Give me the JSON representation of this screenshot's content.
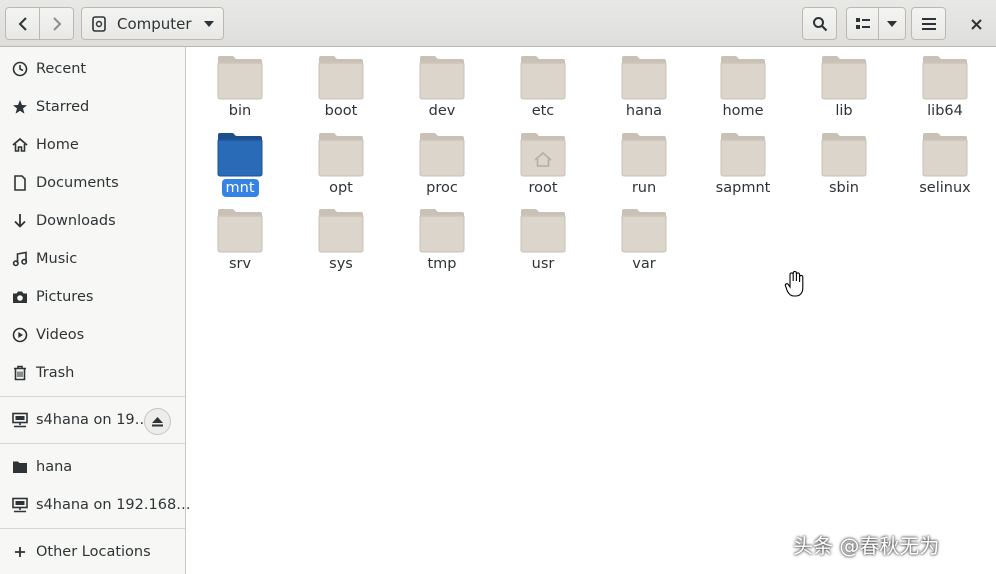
{
  "header": {
    "location_label": "Computer"
  },
  "sidebar": {
    "items": [
      {
        "label": "Recent",
        "icon": "clock-icon"
      },
      {
        "label": "Starred",
        "icon": "star-icon"
      },
      {
        "label": "Home",
        "icon": "home-icon"
      },
      {
        "label": "Documents",
        "icon": "document-icon"
      },
      {
        "label": "Downloads",
        "icon": "download-icon"
      },
      {
        "label": "Music",
        "icon": "music-icon"
      },
      {
        "label": "Pictures",
        "icon": "camera-icon"
      },
      {
        "label": "Videos",
        "icon": "video-icon"
      },
      {
        "label": "Trash",
        "icon": "trash-icon"
      }
    ],
    "network_mount": {
      "label": "s4hana on 19…",
      "icon": "network-drive-icon"
    },
    "bookmarks": [
      {
        "label": "hana",
        "icon": "folder-icon"
      },
      {
        "label": "s4hana on 192.168…",
        "icon": "network-drive-icon"
      }
    ],
    "other_locations": {
      "label": "Other Locations",
      "icon": "plus-icon"
    }
  },
  "files": [
    {
      "name": "bin"
    },
    {
      "name": "boot"
    },
    {
      "name": "dev"
    },
    {
      "name": "etc"
    },
    {
      "name": "hana"
    },
    {
      "name": "home"
    },
    {
      "name": "lib"
    },
    {
      "name": "lib64"
    },
    {
      "name": "mnt",
      "selected": true
    },
    {
      "name": "opt"
    },
    {
      "name": "proc"
    },
    {
      "name": "root",
      "icon": "home-folder"
    },
    {
      "name": "run"
    },
    {
      "name": "sapmnt"
    },
    {
      "name": "sbin"
    },
    {
      "name": "selinux"
    },
    {
      "name": "srv"
    },
    {
      "name": "sys"
    },
    {
      "name": "tmp"
    },
    {
      "name": "usr"
    },
    {
      "name": "var"
    }
  ],
  "watermark": "头条 @春秋无为",
  "colors": {
    "folder": "#dcd5cc",
    "folder_tab": "#c9c0b6",
    "folder_selected": "#2a6bb8",
    "selection": "#3584e4"
  }
}
